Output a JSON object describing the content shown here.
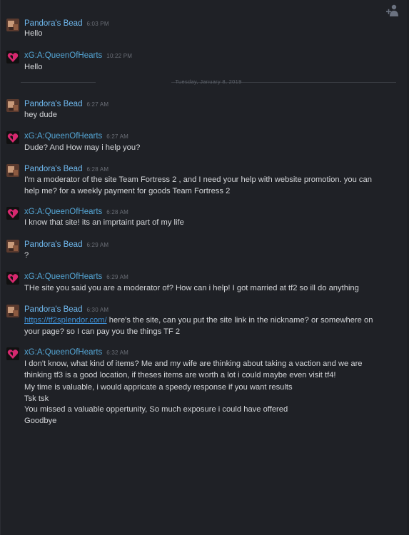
{
  "users": {
    "pandora": "Pandora's Bead",
    "queen": "xG:A:QueenOfHearts"
  },
  "divider": "Tuesday, January 8, 2019",
  "messages": [
    {
      "user": "pandora",
      "time": "6:03 PM",
      "lines": [
        "Hello"
      ]
    },
    {
      "user": "queen",
      "time": "10:22 PM",
      "lines": [
        "Hello"
      ]
    },
    {
      "user": "pandora",
      "time": "6:27 AM",
      "lines": [
        "hey dude"
      ]
    },
    {
      "user": "queen",
      "time": "6:27 AM",
      "lines": [
        "Dude? And How may i help you?"
      ]
    },
    {
      "user": "pandora",
      "time": "6:28 AM",
      "lines": [
        "I'm a moderator of the site Team Fortress 2 , and I need your help with website promotion. you can",
        "help me? for a weekly payment for goods Team Fortress 2"
      ]
    },
    {
      "user": "queen",
      "time": "6:28 AM",
      "lines": [
        "I know that site! its an imprtaint part of my life"
      ]
    },
    {
      "user": "pandora",
      "time": "6:29 AM",
      "lines": [
        "?"
      ]
    },
    {
      "user": "queen",
      "time": "6:29 AM",
      "lines": [
        "THe site you said you are a moderator of? How can i help! I got married at tf2 so ill do anything"
      ]
    },
    {
      "user": "pandora",
      "time": "6:30 AM",
      "link": "https://tf2splendor.com/",
      "lines": [
        " here's the site, can you put the site link in the nickname? or somewhere on",
        "your page? so I can pay you the things TF 2"
      ]
    },
    {
      "user": "queen",
      "time": "6:32 AM",
      "lines": [
        "I don't know, what kind of items? Me and my wife are thinking about taking a vaction and we are",
        "thinking tf3 is a good location, if theses items are worth a lot i could maybe even visit tf4!"
      ]
    }
  ],
  "followups": [
    "My time is valuable, i would appricate a speedy response if you want results",
    "Tsk tsk",
    "You missed a valuable oppertunity, So much exposure i could have offered",
    "Goodbye"
  ],
  "icons": {
    "top_action": "add-user-icon",
    "pandora_avatar": "pandora-avatar",
    "queen_avatar": "heart-avatar"
  }
}
